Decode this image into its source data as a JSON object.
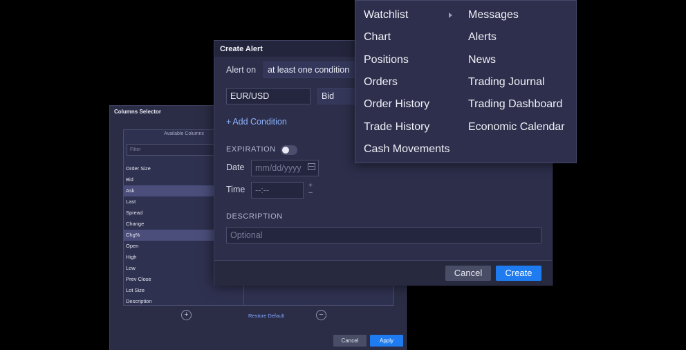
{
  "columns_selector": {
    "title": "Columns Selector",
    "available_header": "Available Columns",
    "filter_placeholder": "Filter",
    "items": [
      {
        "label": "Order Size",
        "selected": false
      },
      {
        "label": "Bid",
        "selected": false
      },
      {
        "label": "Ask",
        "selected": true
      },
      {
        "label": "Last",
        "selected": false
      },
      {
        "label": "Spread",
        "selected": false
      },
      {
        "label": "Change",
        "selected": false
      },
      {
        "label": "Chg%",
        "selected": true
      },
      {
        "label": "Open",
        "selected": false
      },
      {
        "label": "High",
        "selected": false
      },
      {
        "label": "Low",
        "selected": false
      },
      {
        "label": "Prev Close",
        "selected": false
      },
      {
        "label": "Lot Size",
        "selected": false
      },
      {
        "label": "Description",
        "selected": false
      }
    ],
    "add_icon": "plus-circle-icon",
    "remove_icon": "minus-circle-icon",
    "restore_label": "Restore Default",
    "cancel_label": "Cancel",
    "apply_label": "Apply"
  },
  "create_alert": {
    "title": "Create Alert",
    "alert_on_label": "Alert on",
    "alert_on_value": "at least one condition",
    "symbol_value": "EUR/USD",
    "price_type_value": "Bid",
    "add_condition_label": "Add Condition",
    "expiration_label": "EXPIRATION",
    "expiration_enabled": false,
    "date_label": "Date",
    "date_placeholder": "mm/dd/yyyy",
    "time_label": "Time",
    "time_placeholder": "--:--",
    "description_label": "DESCRIPTION",
    "description_placeholder": "Optional",
    "cancel_label": "Cancel",
    "create_label": "Create"
  },
  "menu": {
    "left": [
      "Watchlist",
      "Chart",
      "Positions",
      "Orders",
      "Order History",
      "Trade History",
      "Cash Movements"
    ],
    "right": [
      "Messages",
      "Alerts",
      "News",
      "Trading Journal",
      "Trading Dashboard",
      "Economic Calendar"
    ]
  },
  "colors": {
    "accent": "#1e7cf0",
    "link": "#8eb4ff",
    "panel": "#2c2e4a",
    "selected_row": "#4b4e7a"
  }
}
